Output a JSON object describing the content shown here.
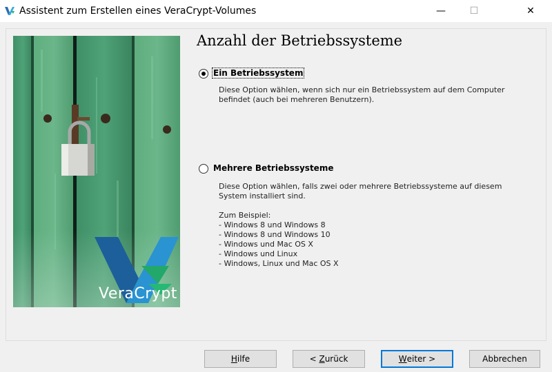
{
  "window": {
    "title": "Assistent zum Erstellen eines VeraCrypt-Volumes"
  },
  "controls": {
    "minimize": "—",
    "maximize": "☐",
    "close": "✕"
  },
  "brand": {
    "logo_text": "VeraCrypt",
    "accent": "#1f8fd0"
  },
  "page": {
    "heading": "Anzahl der Betriebssysteme"
  },
  "options": [
    {
      "label": "Ein Betriebssystem",
      "selected": true,
      "description": [
        "Diese Option wählen, wenn sich nur ein Betriebssystem auf dem Computer",
        "befindet (auch bei mehreren Benutzern)."
      ]
    },
    {
      "label": "Mehrere Betriebssysteme",
      "selected": false,
      "description": [
        "Diese Option wählen, falls zwei oder mehrere Betriebssysteme auf diesem",
        "System installiert sind.",
        "",
        "Zum Beispiel:",
        "- Windows 8 und Windows 8",
        "- Windows 8 und Windows 10",
        "- Windows und Mac OS X",
        "- Windows und Linux",
        "- Windows, Linux und Mac OS X"
      ]
    }
  ],
  "buttons": {
    "help": {
      "before": "",
      "accel": "H",
      "after": "ilfe"
    },
    "back": {
      "before": "< ",
      "accel": "Z",
      "after": "urück"
    },
    "next": {
      "before": "",
      "accel": "W",
      "after": "eiter >"
    },
    "cancel": "Abbrechen"
  }
}
